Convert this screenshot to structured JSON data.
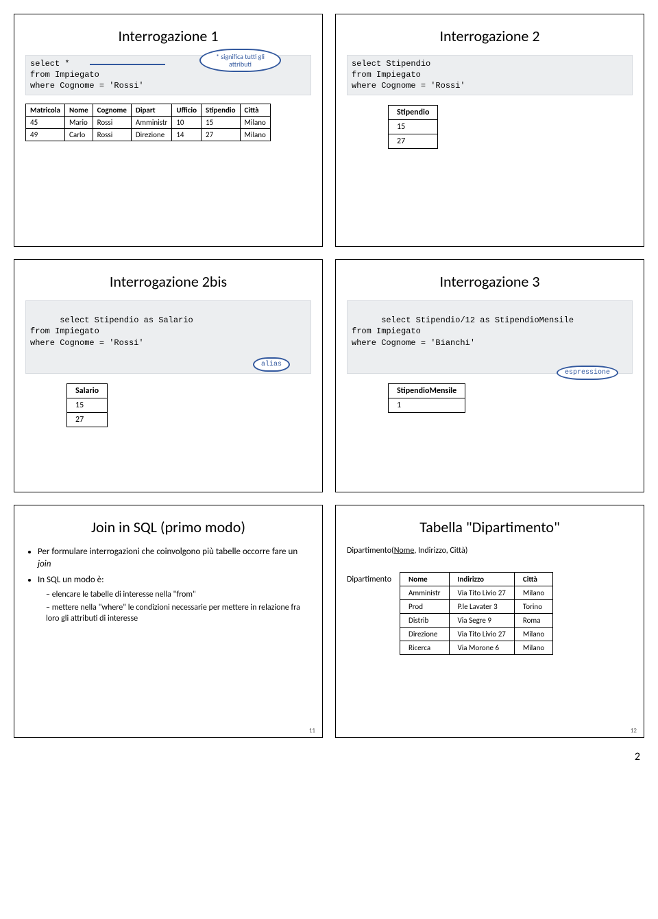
{
  "pageNumber": "2",
  "slides": {
    "s1": {
      "title": "Interrogazione 1",
      "sql": "select *\nfrom Impiegato\nwhere Cognome = 'Rossi'",
      "note": "* significa tutti gli attributi",
      "tbl": {
        "headers": [
          "Matricola",
          "Nome",
          "Cognome",
          "Dipart",
          "Ufficio",
          "Stipendio",
          "Città"
        ],
        "rows": [
          [
            "45",
            "Mario",
            "Rossi",
            "Amministr",
            "10",
            "15",
            "Milano"
          ],
          [
            "49",
            "Carlo",
            "Rossi",
            "Direzione",
            "14",
            "27",
            "Milano"
          ]
        ]
      }
    },
    "s2": {
      "title": "Interrogazione 2",
      "sql": "select Stipendio\nfrom Impiegato\nwhere Cognome = 'Rossi'",
      "res": {
        "header": "Stipendio",
        "rows": [
          "15",
          "27"
        ]
      }
    },
    "s3": {
      "title": "Interrogazione 2bis",
      "sql": "select Stipendio as Salario\nfrom Impiegato\nwhere Cognome = 'Rossi'",
      "tag": "alias",
      "res": {
        "header": "Salario",
        "rows": [
          "15",
          "27"
        ]
      }
    },
    "s4": {
      "title": "Interrogazione 3",
      "sql": "select Stipendio/12 as StipendioMensile\nfrom Impiegato\nwhere Cognome = 'Bianchi'",
      "tag": "espressione",
      "res": {
        "header": "StipendioMensile",
        "rows": [
          "1"
        ]
      }
    },
    "s5": {
      "title": "Join in SQL (primo modo)",
      "b1": "Per formulare interrogazioni che coinvolgono più tabelle occorre fare un ",
      "b1i": "join",
      "b2": "In SQL un modo è:",
      "b2a": "elencare le tabelle di interesse nella \"from\"",
      "b2b": "mettere nella \"where\" le condizioni necessarie per mettere in relazione fra loro gli attributi di interesse",
      "pg": "11"
    },
    "s6": {
      "title": "Tabella \"Dipartimento\"",
      "schema_pre": "Dipartimento(",
      "schema_u": "Nome",
      "schema_post": ", Indirizzo, Città)",
      "label": "Dipartimento",
      "tbl": {
        "headers": [
          "Nome",
          "Indirizzo",
          "Città"
        ],
        "rows": [
          [
            "Amministr",
            "Via Tito Livio 27",
            "Milano"
          ],
          [
            "Prod",
            "P.le Lavater 3",
            "Torino"
          ],
          [
            "Distrib",
            "Via Segre 9",
            "Roma"
          ],
          [
            "Direzione",
            "Via Tito Livio 27",
            "Milano"
          ],
          [
            "Ricerca",
            "Via Morone 6",
            "Milano"
          ]
        ]
      },
      "pg": "12"
    }
  },
  "chart_data": [
    {
      "type": "table",
      "title": "Interrogazione 1 result",
      "headers": [
        "Matricola",
        "Nome",
        "Cognome",
        "Dipart",
        "Ufficio",
        "Stipendio",
        "Città"
      ],
      "rows": [
        [
          "45",
          "Mario",
          "Rossi",
          "Amministr",
          "10",
          "15",
          "Milano"
        ],
        [
          "49",
          "Carlo",
          "Rossi",
          "Direzione",
          "14",
          "27",
          "Milano"
        ]
      ]
    },
    {
      "type": "table",
      "title": "Interrogazione 2 result",
      "headers": [
        "Stipendio"
      ],
      "rows": [
        [
          "15"
        ],
        [
          "27"
        ]
      ]
    },
    {
      "type": "table",
      "title": "Interrogazione 2bis result",
      "headers": [
        "Salario"
      ],
      "rows": [
        [
          "15"
        ],
        [
          "27"
        ]
      ]
    },
    {
      "type": "table",
      "title": "Interrogazione 3 result",
      "headers": [
        "StipendioMensile"
      ],
      "rows": [
        [
          "1"
        ]
      ]
    },
    {
      "type": "table",
      "title": "Dipartimento",
      "headers": [
        "Nome",
        "Indirizzo",
        "Città"
      ],
      "rows": [
        [
          "Amministr",
          "Via Tito Livio 27",
          "Milano"
        ],
        [
          "Prod",
          "P.le Lavater 3",
          "Torino"
        ],
        [
          "Distrib",
          "Via Segre 9",
          "Roma"
        ],
        [
          "Direzione",
          "Via Tito Livio 27",
          "Milano"
        ],
        [
          "Ricerca",
          "Via Morone 6",
          "Milano"
        ]
      ]
    }
  ]
}
